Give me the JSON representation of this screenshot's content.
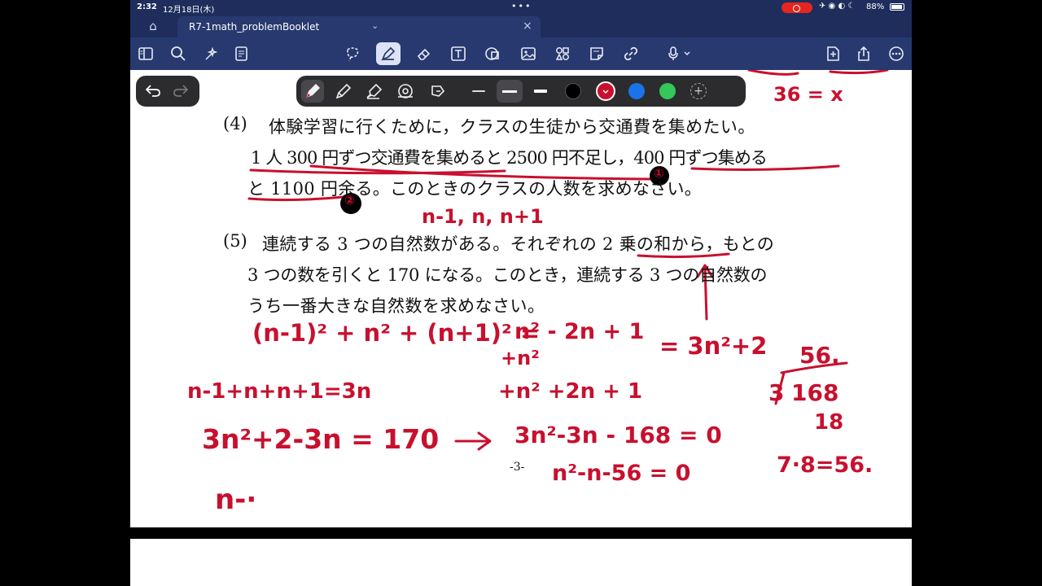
{
  "status_bar": {
    "time": "2:32",
    "date": "12月18日(木)",
    "battery": "88%"
  },
  "tab": {
    "title": "R7-1math_problemBooklet"
  },
  "toolbar": {
    "icons": [
      "sidebar-icon",
      "search-icon",
      "sparkle-icon",
      "outline-icon",
      "lasso-icon",
      "pen-icon",
      "eraser-icon",
      "textbox-icon",
      "shapes-icon",
      "image-icon",
      "sticker-icon",
      "note-icon",
      "link-icon",
      "mic-icon",
      "add-page-icon",
      "share-icon",
      "more-icon"
    ],
    "active": "pen-icon",
    "accent": "#27396e"
  },
  "pen_palette": {
    "selected_color": "#c8102e",
    "colors": [
      "#000000",
      "#c8102e",
      "#1a73e8",
      "#34c759"
    ]
  },
  "page": {
    "page_number": "-3-",
    "q4": {
      "number": "(4)",
      "line1": "体験学習に行くために，クラスの生徒から交通費を集めたい。",
      "line2": "1 人 300 円ずつ交通費を集めると 2500 円不足し，400 円ずつ集める",
      "line3": "と 1100 円余る。このときのクラスの人数を求めなさい。"
    },
    "q5": {
      "number": "(5)",
      "line1": "連続する 3 つの自然数がある。それぞれの 2 乗の和から，もとの",
      "line2": "3 つの数を引くと 170 になる。このとき，連続する 3 つの自然数の",
      "line3": "うち一番大きな自然数を求めなさい。"
    }
  },
  "handwriting": {
    "top_right_1": "36 = x",
    "circle1": "①",
    "circle2": "②",
    "seq": "n-1, n, n+1",
    "expansion_left": "(n-1)² + n² + (n+1)² =",
    "expansion_r1": "n² - 2n + 1",
    "expansion_r2": "+n²",
    "expansion_r3": "+n² +2n + 1",
    "result": "= 3n²+2",
    "sum": "n-1+n+n+1=3n",
    "eq1": "3n²+2-3n = 170",
    "arrow": "→",
    "eq2": "3n²-3n - 168 = 0",
    "eq3": "n²-n-56 = 0",
    "div_quot": "56.",
    "div_dividend": "168",
    "div_divisor": "3",
    "div_sub": "18",
    "product": "7·8=56.",
    "n_partial": "n-·"
  }
}
